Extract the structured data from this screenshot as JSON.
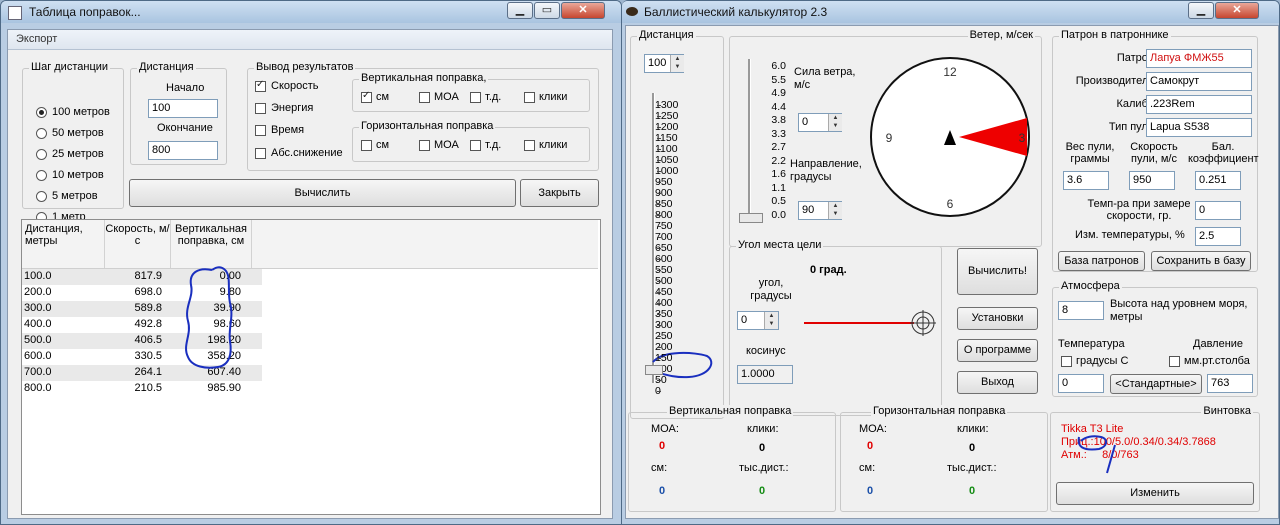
{
  "left_window": {
    "title": "Таблица поправок...",
    "menu_export": "Экспорт",
    "step_group": {
      "title": "Шаг дистанции",
      "options": [
        "100 метров",
        "50 метров",
        "25 метров",
        "10 метров",
        "5 метров",
        "1 метр"
      ],
      "selected": "100 метров"
    },
    "distance_group": {
      "title": "Дистанция",
      "start_label": "Начало",
      "start_value": "100",
      "end_label": "Окончание",
      "end_value": "800"
    },
    "output_group": {
      "title": "Вывод результатов",
      "speed": "Скорость",
      "energy": "Энергия",
      "time": "Время",
      "abs_drop": "Абс.снижение",
      "vertical_title": "Вертикальная поправка,",
      "horizontal_title": "Горизонтальная поправка",
      "unit_cm": "см",
      "unit_moa": "МОА",
      "unit_td": "т.д.",
      "unit_clicks": "клики"
    },
    "calculate_button": "Вычислить",
    "close_button": "Закрыть",
    "table": {
      "headers": [
        "Дистанция, метры",
        "Скорость, м/с",
        "Вертикальная поправка, см"
      ],
      "rows": [
        [
          "100.0",
          "817.9",
          "0.00"
        ],
        [
          "200.0",
          "698.0",
          "9.80"
        ],
        [
          "300.0",
          "589.8",
          "39.90"
        ],
        [
          "400.0",
          "492.8",
          "98.60"
        ],
        [
          "500.0",
          "406.5",
          "198.20"
        ],
        [
          "600.0",
          "330.5",
          "358.20"
        ],
        [
          "700.0",
          "264.1",
          "607.40"
        ],
        [
          "800.0",
          "210.5",
          "985.90"
        ]
      ]
    }
  },
  "right_window": {
    "title": "Баллистический калькулятор 2.3",
    "distance_group": {
      "title": "Дистанция",
      "value": "100",
      "ticks": [
        "1300",
        "1250",
        "1200",
        "1150",
        "1100",
        "1050",
        "1000",
        "950",
        "900",
        "850",
        "800",
        "750",
        "700",
        "650",
        "600",
        "550",
        "500",
        "450",
        "400",
        "350",
        "300",
        "250",
        "200",
        "150",
        "100",
        "50",
        "0"
      ],
      "selected": 100
    },
    "wind_group": {
      "title": "Ветер, м/сек",
      "ticks": [
        "6.0",
        "5.5",
        "4.9",
        "4.4",
        "3.8",
        "3.3",
        "2.7",
        "2.2",
        "1.6",
        "1.1",
        "0.5",
        "0.0"
      ],
      "strength_label": "Сила ветра, м/с",
      "strength_value": "0",
      "direction_label": "Направление, градусы",
      "direction_value": "90",
      "clock_12": "12",
      "clock_3": "3",
      "clock_6": "6",
      "clock_9": "9",
      "wind_level": 0
    },
    "target_angle_group": {
      "title": "Угол места цели",
      "display": "0 град.",
      "angle_label": "угол, градусы",
      "angle_value": "0",
      "cosine_label": "косинус",
      "cosine_value": "1.0000"
    },
    "buttons": {
      "calculate": "Вычислить!",
      "settings": "Установки",
      "about": "О программе",
      "exit": "Выход"
    },
    "cartridge_group": {
      "title": "Патрон в патроннике",
      "cartridge_label": "Патрон",
      "cartridge_value": "Лапуа ФМЖ55",
      "maker_label": "Производитель",
      "maker_value": "Самокрут",
      "caliber_label": "Калибр",
      "caliber_value": ".223Rem",
      "bullet_type_label": "Тип пули",
      "bullet_type_value": "Lapua S538",
      "weight_label": "Вес пули, граммы",
      "weight_value": "3.6",
      "speed_label": "Скорость пули, м/с",
      "speed_value": "950",
      "bc_label": "Бал. коэффициент",
      "bc_value": "0.251",
      "temp_label": "Темп-ра при замере скорости, гр.",
      "temp_value": "0",
      "temp_change_label": "Изм. температуры, %",
      "temp_change_value": "2.5",
      "db_button": "База патронов",
      "save_button": "Сохранить в базу"
    },
    "atmosphere_group": {
      "title": "Атмосфера",
      "altitude_value": "8",
      "altitude_label": "Высота над уровнем моря, метры",
      "temperature_label": "Температура",
      "celsius_label": "градусы С",
      "pressure_label": "Давление",
      "mmhg_label": "мм.рт.столба",
      "temperature_value": "0",
      "standard_button": "<Стандартные>",
      "pressure_value": "763"
    },
    "vertical_group": {
      "title": "Вертикальная поправка",
      "moa_label": "МОА:",
      "moa_value": "0",
      "clicks_label": "клики:",
      "clicks_value": "0",
      "cm_label": "см:",
      "cm_value": "0",
      "td_label": "тыс.дист.:",
      "td_value": "0"
    },
    "horizontal_group": {
      "title": "Горизонтальная поправка",
      "moa_label": "МОА:",
      "moa_value": "0",
      "clicks_label": "клики:",
      "clicks_value": "0",
      "cm_label": "см:",
      "cm_value": "0",
      "td_label": "тыс.дист.:",
      "td_value": "0"
    },
    "rifle_group": {
      "title": "Винтовка",
      "name": "Tikka T3 Lite",
      "line1": "Приц.:100/5.0/0.34/0.34/3.7868",
      "line2": "Атм.:     8/0/763",
      "change_button": "Изменить"
    }
  },
  "colors": {
    "accent_red": "#e00000",
    "blue": "#1a4fa8",
    "green": "#148c14",
    "annotation": "#1a2fbf"
  }
}
